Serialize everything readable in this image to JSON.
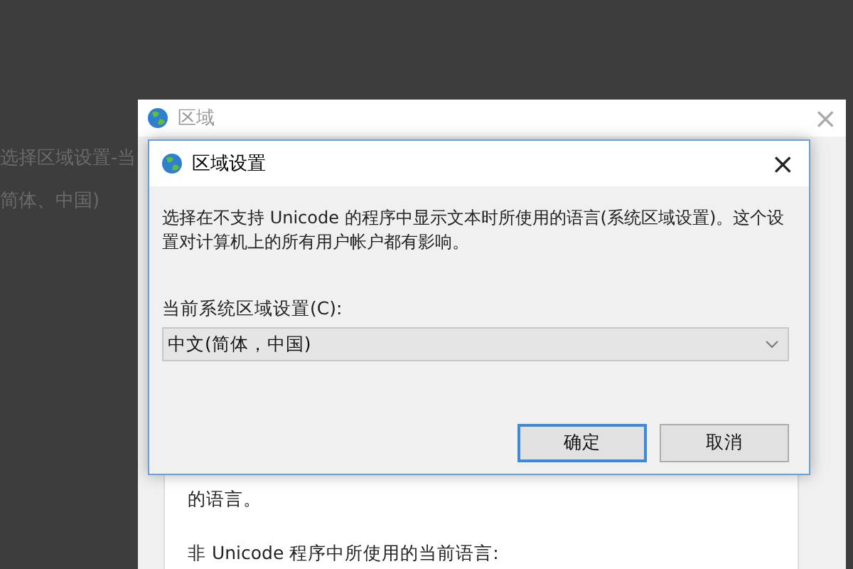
{
  "background_text": [
    "选择区域设置-当",
    "简体、中国)"
  ],
  "back_window": {
    "title": "区域",
    "close": "×",
    "lines": [
      "的语言。",
      "非 Unicode 程序中所使用的当前语言:"
    ]
  },
  "dialog": {
    "title": "区域设置",
    "close": "×",
    "description": "选择在不支持 Unicode 的程序中显示文本时所使用的语言(系统区域设置)。这个设置对计算机上的所有用户帐户都有影响。",
    "locale_label": "当前系统区域设置(C):",
    "locale_value": "中文(简体，中国)",
    "buttons": [
      {
        "label": "确定",
        "selected": true
      },
      {
        "label": "取消",
        "selected": false
      }
    ]
  }
}
